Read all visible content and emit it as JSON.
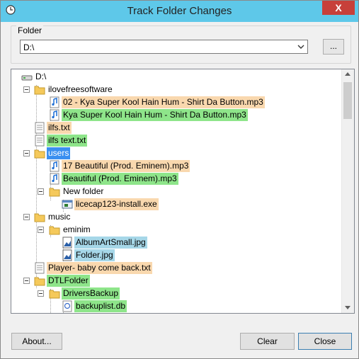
{
  "window": {
    "title": "Track Folder Changes",
    "close_glyph": "X"
  },
  "folder": {
    "group_label": "Folder",
    "path_value": "D:\\",
    "browse_label": "..."
  },
  "tree": {
    "root": "D:\\",
    "items": [
      {
        "label": "ilovefreesoftware"
      },
      {
        "label": "02 - Kya Super Kool Hain Hum - Shirt Da Button.mp3"
      },
      {
        "label": "Kya Super Kool Hain Hum - Shirt Da Button.mp3"
      },
      {
        "label": "ilfs.txt"
      },
      {
        "label": "ilfs text.txt"
      },
      {
        "label": "users"
      },
      {
        "label": "17 Beautiful (Prod. Eminem).mp3"
      },
      {
        "label": "Beautiful (Prod. Eminem).mp3"
      },
      {
        "label": "New folder"
      },
      {
        "label": "licecap123-install.exe"
      },
      {
        "label": "music"
      },
      {
        "label": "eminim"
      },
      {
        "label": "AlbumArtSmall.jpg"
      },
      {
        "label": "Folder.jpg"
      },
      {
        "label": "Player- baby come back.txt"
      },
      {
        "label": "DTLFolder"
      },
      {
        "label": "DriversBackup"
      },
      {
        "label": "backuplist.db"
      }
    ]
  },
  "buttons": {
    "about": "About...",
    "clear": "Clear",
    "close": "Close"
  },
  "colors": {
    "titlebar": "#5ec8e9",
    "deleted_highlight": "#f9d8ae",
    "added_highlight": "#8ee58a",
    "modified_highlight": "#a6d7e8",
    "selected_highlight": "#3a8ff0"
  },
  "icons": {
    "app": "clock-icon",
    "drive": "drive-icon",
    "folder": "folder-icon",
    "music": "music-note-icon",
    "text": "text-file-icon",
    "image": "image-file-icon",
    "exe": "exe-file-icon",
    "db": "db-file-icon"
  }
}
